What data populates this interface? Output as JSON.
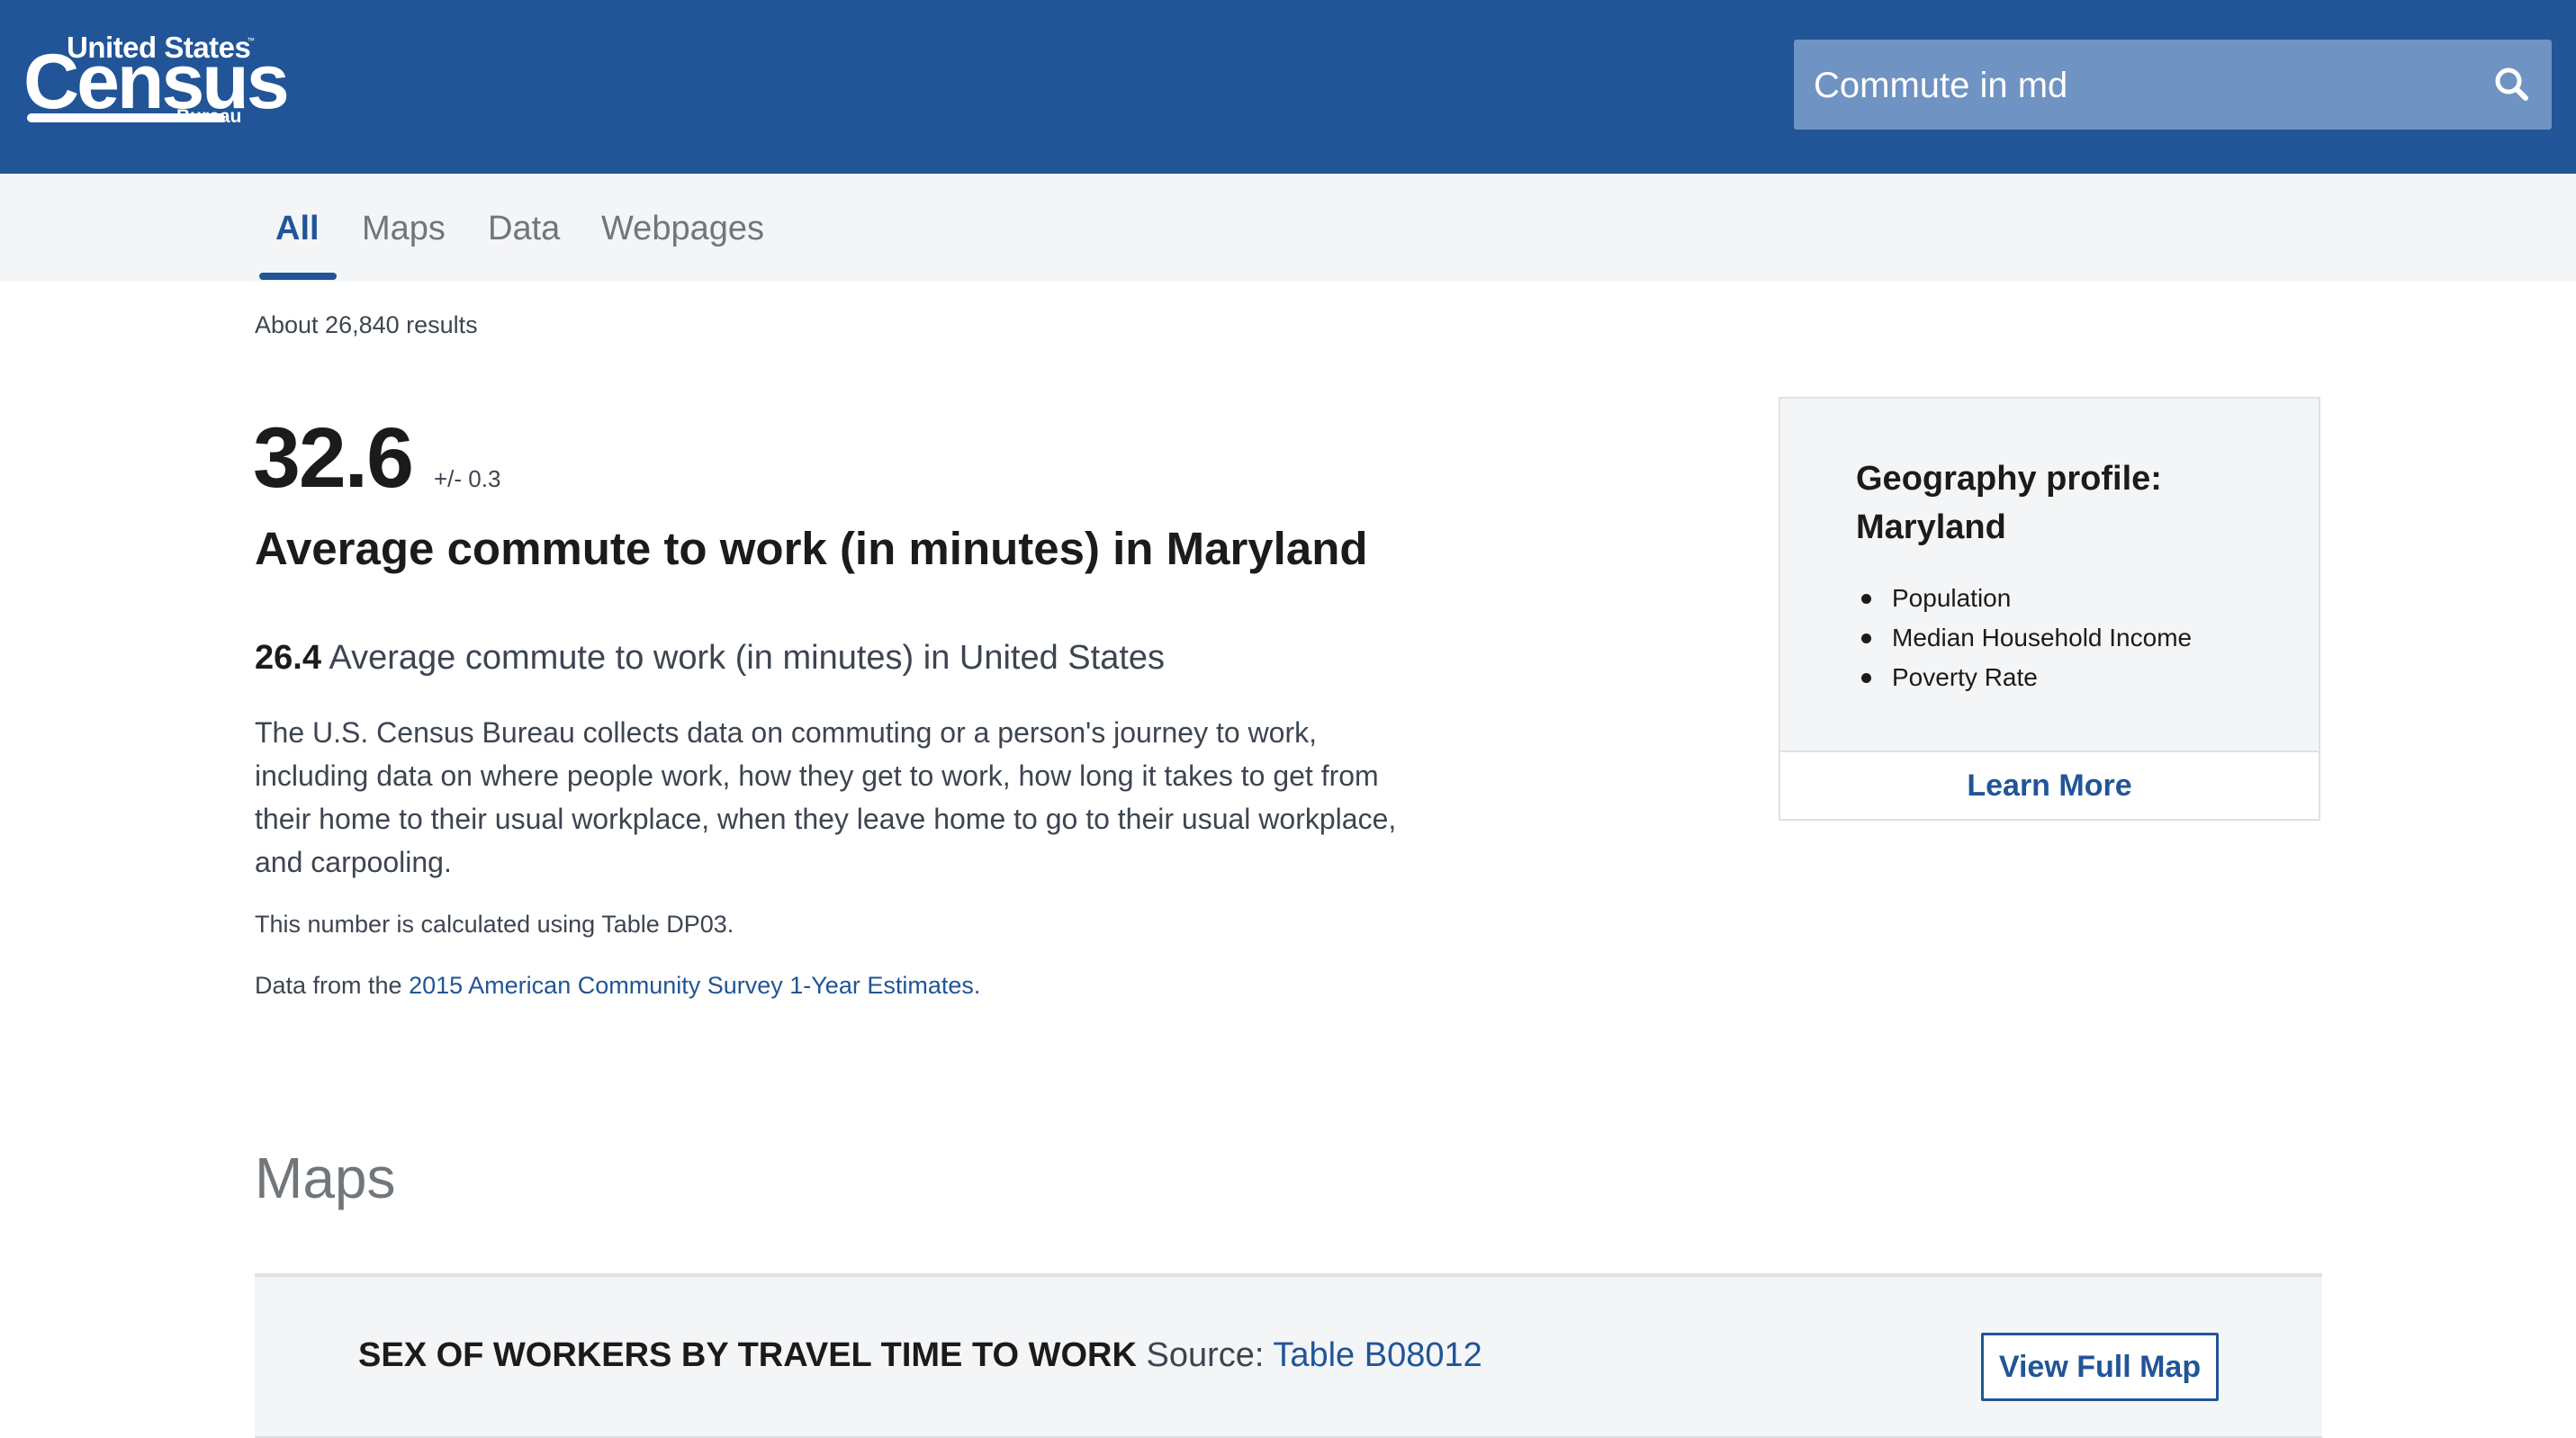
{
  "header": {
    "logo": {
      "line1": "United States",
      "tm": "™",
      "line2": "Census",
      "line3": "Bureau"
    },
    "search": {
      "value": "Commute in md",
      "placeholder": ""
    },
    "search_icon": "search-icon"
  },
  "tabs": [
    {
      "label": "All",
      "active": true
    },
    {
      "label": "Maps",
      "active": false
    },
    {
      "label": "Data",
      "active": false
    },
    {
      "label": "Webpages",
      "active": false
    }
  ],
  "results_count": "About 26,840 results",
  "stat": {
    "value": "32.6",
    "moe": "+/- 0.3",
    "title": "Average commute to work (in minutes) in Maryland",
    "compare_value": "26.4",
    "compare_text": "Average commute to work (in minutes) in United States",
    "description": "The U.S. Census Bureau collects data on commuting or a person's journey to work, including data on where people work, how they get to work, how long it takes to get from their home to their usual workplace, when they leave home to go to their usual workplace, and carpooling.",
    "table_note": "This number is calculated using Table DP03.",
    "source_prefix": "Data from the",
    "source_link": "2015 American Community Survey 1-Year Estimates."
  },
  "geography_card": {
    "title": "Geography profile: Maryland",
    "items": [
      "Population",
      "Median Household Income",
      "Poverty Rate"
    ],
    "learn_more": "Learn More"
  },
  "maps_section": {
    "heading": "Maps",
    "card": {
      "title": "SEX OF WORKERS BY TRAVEL TIME TO WORK",
      "source_label": "Source:",
      "source_link": "Table B08012",
      "button": "View Full Map"
    }
  },
  "colors": {
    "brand_blue": "#215597",
    "search_bg": "#6f93c2",
    "tab_bar_bg": "#f4f5f7",
    "muted_text": "#71767a"
  }
}
